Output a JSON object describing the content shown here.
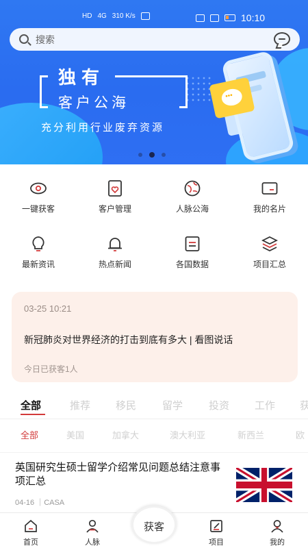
{
  "status_bar": {
    "left_text": "HD",
    "network": "4G",
    "speed": "310 K/s",
    "time": "10:10"
  },
  "search": {
    "placeholder": "搜索",
    "chat_icon": "chat-bubble-icon"
  },
  "banner": {
    "title": "独有",
    "subtitle": "客户公海",
    "tagline": "充分利用行业废弃资源",
    "dots": 3,
    "active_dot": 2
  },
  "features": [
    {
      "label": "一键获客",
      "icon": "eye-icon"
    },
    {
      "label": "客户管理",
      "icon": "heart-card-icon"
    },
    {
      "label": "人脉公海",
      "icon": "globe-icon"
    },
    {
      "label": "我的名片",
      "icon": "card-icon"
    },
    {
      "label": "最新资讯",
      "icon": "bulb-icon"
    },
    {
      "label": "热点新闻",
      "icon": "bell-icon"
    },
    {
      "label": "各国数据",
      "icon": "document-icon"
    },
    {
      "label": "项目汇总",
      "icon": "layers-icon"
    }
  ],
  "notice": {
    "time": "03-25 10:21",
    "title": "新冠肺炎对世界经济的打击到底有多大 | 看图说话",
    "summary": "今日已获客1人"
  },
  "tabs": [
    "全部",
    "推荐",
    "移民",
    "留学",
    "投资",
    "工作",
    "获"
  ],
  "active_tab": "全部",
  "sub_tabs": [
    "全部",
    "美国",
    "加拿大",
    "澳大利亚",
    "新西兰",
    "欧"
  ],
  "active_sub_tab": "全部",
  "article": {
    "headline": "英国研究生硕士留学介绍常见问题总结注意事项汇总",
    "date": "04-16",
    "source": "CASA",
    "meta": "04-16 ｜CASA",
    "thumb_icon": "uk-flag-icon"
  },
  "nav": {
    "items": [
      {
        "label": "首页",
        "icon": "home-icon"
      },
      {
        "label": "人脉",
        "icon": "contacts-icon"
      },
      {
        "label": "项目",
        "icon": "edit-icon"
      },
      {
        "label": "我的",
        "icon": "user-icon"
      }
    ],
    "center_label": "获客"
  },
  "colors": {
    "banner_blue": "#2a6cf0",
    "accent_red": "#d23a3a",
    "notice_bg": "#fdf0ea"
  }
}
